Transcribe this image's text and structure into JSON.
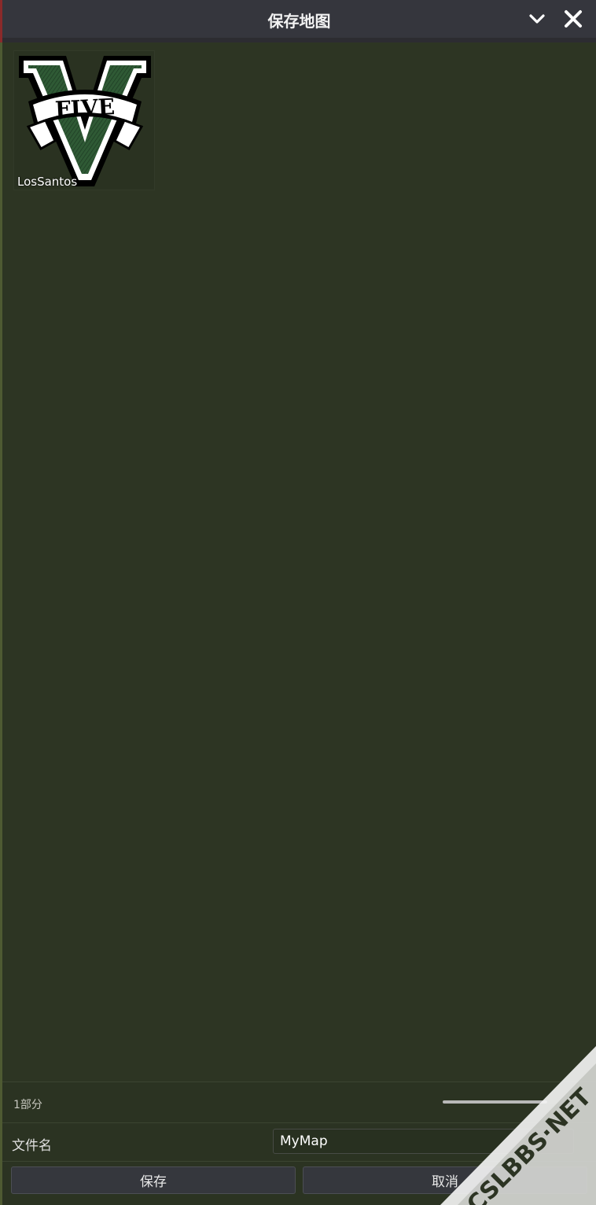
{
  "window": {
    "title": "保存地图",
    "collapse_icon": "chevron-down-icon",
    "close_icon": "close-icon"
  },
  "maps": [
    {
      "name": "LosSantos",
      "thumbnail_text": "FIVE",
      "thumbnail_icon": "gta-v-logo"
    }
  ],
  "footer": {
    "count_text": "1部分",
    "slider_value": 0.7,
    "file_label": "文件名",
    "file_value": "MyMap",
    "save_label": "保存",
    "cancel_label": "取消"
  },
  "watermark": {
    "text": "CSLBBS·NET"
  },
  "colors": {
    "background": "#2c3423",
    "titlebar": "#35363d",
    "button": "#35373d",
    "watermark": "#ffffff"
  }
}
